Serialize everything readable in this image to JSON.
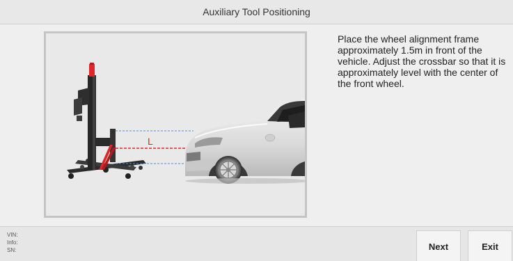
{
  "header": {
    "title": "Auxiliary Tool Positioning"
  },
  "main": {
    "diagram_label": "L",
    "instructions": "Place the wheel alignment frame approximately 1.5m in front of the vehicle. Adjust the crossbar so that it is approximately level with the center of the front wheel."
  },
  "footer": {
    "vin_label": "VIN:",
    "info_label": "Info:",
    "sn_label": "SN:",
    "next_label": "Next",
    "exit_label": "Exit"
  },
  "colors": {
    "accent_red": "#e0262b",
    "frame_border": "#c4c4c4"
  }
}
